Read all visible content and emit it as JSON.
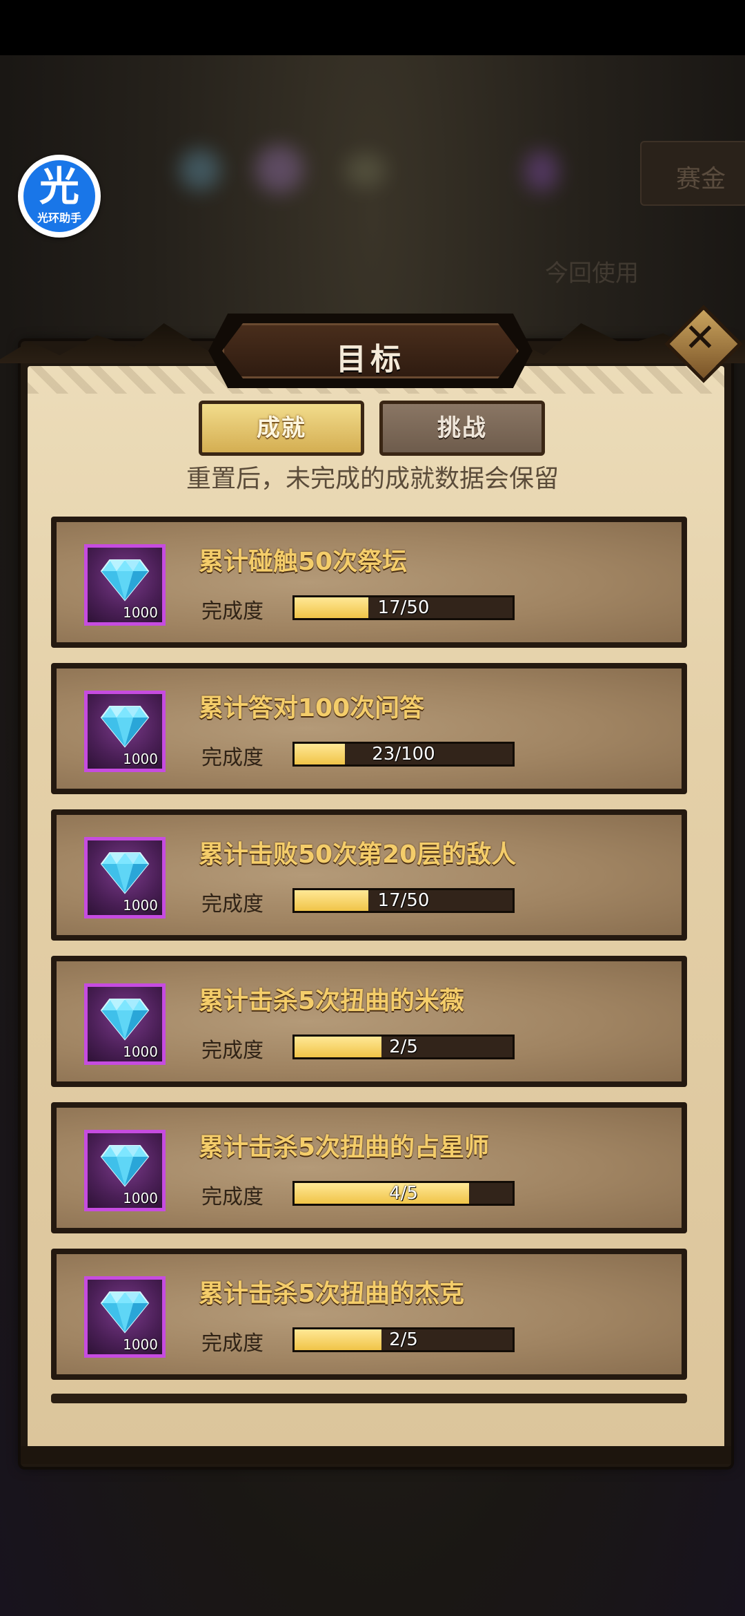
{
  "helper": {
    "logo_char": "光",
    "logo_text": "光环助手"
  },
  "background": {
    "button_label": "赛金",
    "caption": "今回使用"
  },
  "panel": {
    "title": "目标",
    "close_label": "✕"
  },
  "tabs": [
    {
      "label": "成就",
      "active": true
    },
    {
      "label": "挑战",
      "active": false
    }
  ],
  "notice": "重置后，未完成的成就数据会保留",
  "progress_label": "完成度",
  "colors": {
    "gold": "#f4cd6a",
    "reward_border": "#c64ce0",
    "progress_fill": "#f0c448"
  },
  "achievements": [
    {
      "title": "累计碰触50次祭坛",
      "reward_icon": "diamond-icon",
      "reward_qty": "1000",
      "progress_text": "17/50",
      "progress": 0.34
    },
    {
      "title": "累计答对100次问答",
      "reward_icon": "diamond-icon",
      "reward_qty": "1000",
      "progress_text": "23/100",
      "progress": 0.23
    },
    {
      "title": "累计击败50次第20层的敌人",
      "reward_icon": "diamond-icon",
      "reward_qty": "1000",
      "progress_text": "17/50",
      "progress": 0.34
    },
    {
      "title": "累计击杀5次扭曲的米薇",
      "reward_icon": "diamond-icon",
      "reward_qty": "1000",
      "progress_text": "2/5",
      "progress": 0.4
    },
    {
      "title": "累计击杀5次扭曲的占星师",
      "reward_icon": "diamond-icon",
      "reward_qty": "1000",
      "progress_text": "4/5",
      "progress": 0.8
    },
    {
      "title": "累计击杀5次扭曲的杰克",
      "reward_icon": "diamond-icon",
      "reward_qty": "1000",
      "progress_text": "2/5",
      "progress": 0.4
    }
  ]
}
